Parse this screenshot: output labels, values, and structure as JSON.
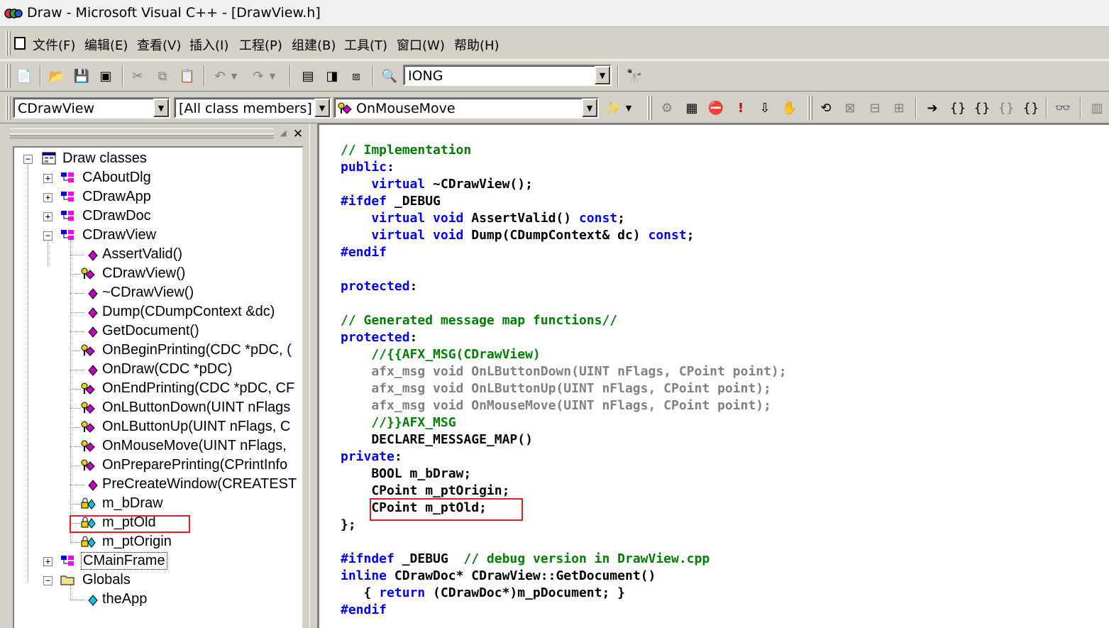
{
  "window": {
    "title": "Draw - Microsoft Visual C++ - [DrawView.h]"
  },
  "menu": [
    "文件(F)",
    "编辑(E)",
    "查看(V)",
    "插入(I)",
    "工程(P)",
    "组建(B)",
    "工具(T)",
    "窗口(W)",
    "帮助(H)"
  ],
  "toolbar": {
    "find_combo_value": "IONG"
  },
  "wizardbar": {
    "class_combo": "CDrawView",
    "filter_combo": "[All class members]",
    "member_combo": "OnMouseMove"
  },
  "classview": {
    "root": "Draw classes",
    "classes": [
      "CAboutDlg",
      "CDrawApp",
      "CDrawDoc",
      "CDrawView"
    ],
    "members": [
      "AssertValid()",
      "CDrawView()",
      "~CDrawView()",
      "Dump(CDumpContext &dc)",
      "GetDocument()",
      "OnBeginPrinting(CDC *pDC, (",
      "OnDraw(CDC *pDC)",
      "OnEndPrinting(CDC *pDC, CF",
      "OnLButtonDown(UINT nFlags",
      "OnLButtonUp(UINT nFlags, C",
      "OnMouseMove(UINT nFlags,",
      "OnPreparePrinting(CPrintInfo",
      "PreCreateWindow(CREATEST",
      "m_bDraw",
      "m_ptOld",
      "m_ptOrigin"
    ],
    "after": [
      "CMainFrame",
      "Globals",
      "theApp"
    ]
  },
  "code": {
    "l1": "// Implementation",
    "l2a": "public",
    "l2b": ":",
    "l3a": "    virtual",
    "l3b": " ~CDrawView();",
    "l4a": "#ifdef",
    "l4b": " _DEBUG",
    "l5a": "    virtual void",
    "l5b": " AssertValid() ",
    "l5c": "const",
    "l5d": ";",
    "l6a": "    virtual void",
    "l6b": " Dump(CDumpContext& dc) ",
    "l6c": "const",
    "l6d": ";",
    "l7": "#endif",
    "l8a": "protected",
    "l8b": ":",
    "l9": "// Generated message map functions//",
    "l10a": "protected",
    "l10b": ":",
    "l11": "    //{{AFX_MSG(CDrawView)",
    "l12": "    afx_msg void OnLButtonDown(UINT nFlags, CPoint point);",
    "l13": "    afx_msg void OnLButtonUp(UINT nFlags, CPoint point);",
    "l14": "    afx_msg void OnMouseMove(UINT nFlags, CPoint point);",
    "l15": "    //}}AFX_MSG",
    "l16": "    DECLARE_MESSAGE_MAP()",
    "l17a": "private",
    "l17b": ":",
    "l18": "    BOOL m_bDraw;",
    "l19": "    CPoint m_ptOrigin;",
    "l20": "    CPoint m_ptOld;",
    "l21": "};",
    "l22a": "#ifndef",
    "l22b": " _DEBUG  ",
    "l22c": "// debug version in DrawView.cpp",
    "l23a": "inline",
    "l23b": " CDrawDoc* CDrawView::GetDocument()",
    "l24a": "   { ",
    "l24b": "return",
    "l24c": " (CDrawDoc*)m_pDocument; }",
    "l25": "#endif"
  },
  "colors": {
    "keyword": "#0000ff",
    "comment": "#008000",
    "disabled": "#808080",
    "highlight_box": "#e02020"
  }
}
